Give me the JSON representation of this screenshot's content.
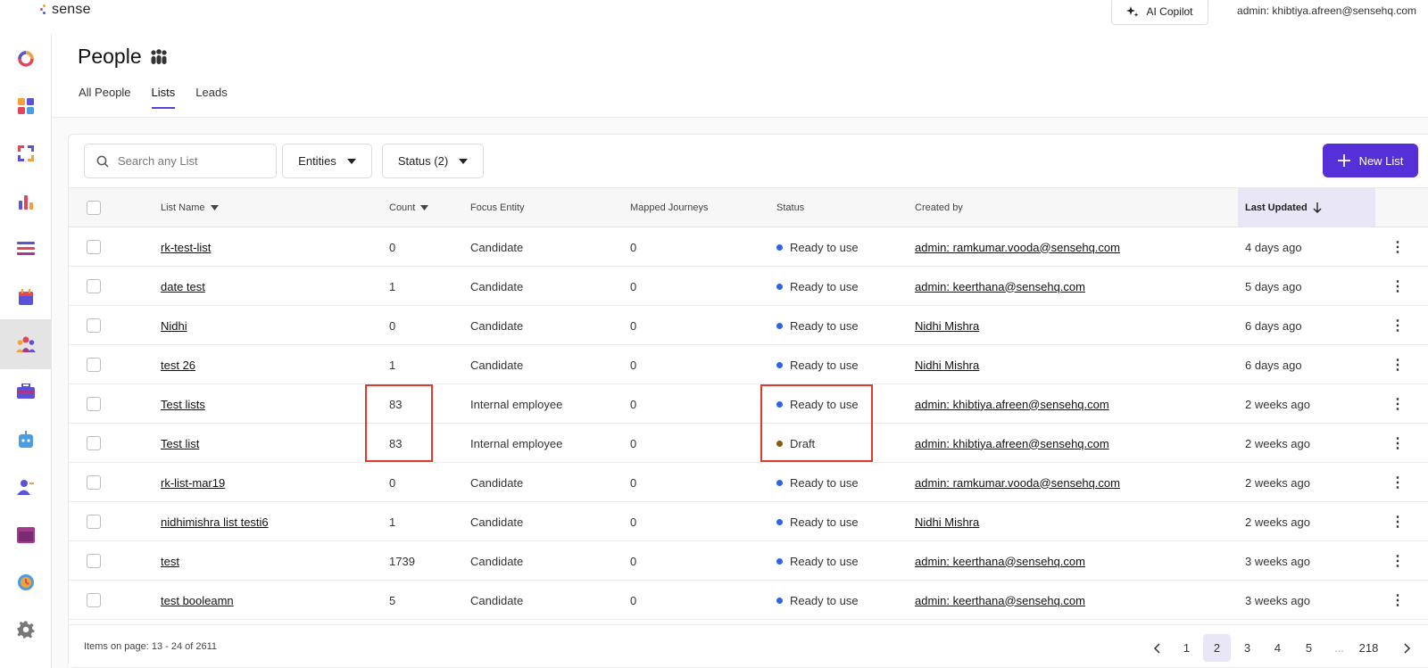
{
  "brand": {
    "name": "sense"
  },
  "topbar": {
    "copilot_label": "AI Copilot",
    "user_label": "admin: khibtiya.afreen@sensehq.com"
  },
  "sidebar": {
    "items": [
      {
        "icon": "ring-icon",
        "active": false
      },
      {
        "icon": "dashboard-icon",
        "active": false
      },
      {
        "icon": "integrations-icon",
        "active": false
      },
      {
        "icon": "analytics-icon",
        "active": false
      },
      {
        "icon": "list-icon",
        "active": false
      },
      {
        "icon": "calendar-icon",
        "active": false
      },
      {
        "icon": "people-icon",
        "active": true
      },
      {
        "icon": "jobs-briefcase-icon",
        "active": false
      },
      {
        "icon": "bot-icon",
        "active": false
      },
      {
        "icon": "user-edit-icon",
        "active": false
      },
      {
        "icon": "window-icon",
        "active": false
      },
      {
        "icon": "clock-icon",
        "active": false
      },
      {
        "icon": "gear-icon",
        "active": false
      }
    ]
  },
  "header": {
    "title": "People",
    "tabs": [
      {
        "label": "All People",
        "active": false
      },
      {
        "label": "Lists",
        "active": true
      },
      {
        "label": "Leads",
        "active": false
      }
    ]
  },
  "toolbar": {
    "search_placeholder": "Search any List",
    "entities_label": "Entities",
    "status_label": "Status (2)",
    "new_list_label": "New List"
  },
  "table": {
    "columns": {
      "list_name": "List Name",
      "count": "Count",
      "focus_entity": "Focus Entity",
      "mapped_journeys": "Mapped Journeys",
      "status": "Status",
      "created_by": "Created by",
      "last_updated": "Last Updated"
    },
    "rows": [
      {
        "name": "rk-test-list",
        "count": "0",
        "focus": "Candidate",
        "journeys": "0",
        "status": "Ready to use",
        "created_by": "admin: ramkumar.vooda@sensehq.com",
        "updated": "4 days ago"
      },
      {
        "name": "date test",
        "count": "1",
        "focus": "Candidate",
        "journeys": "0",
        "status": "Ready to use",
        "created_by": "admin: keerthana@sensehq.com",
        "updated": "5 days ago"
      },
      {
        "name": "Nidhi",
        "count": "0",
        "focus": "Candidate",
        "journeys": "0",
        "status": "Ready to use",
        "created_by": "Nidhi Mishra",
        "updated": "6 days ago"
      },
      {
        "name": "test 26",
        "count": "1",
        "focus": "Candidate",
        "journeys": "0",
        "status": "Ready to use",
        "created_by": "Nidhi Mishra",
        "updated": "6 days ago"
      },
      {
        "name": "Test lists",
        "count": "83",
        "focus": "Internal employee",
        "journeys": "0",
        "status": "Ready to use",
        "created_by": "admin: khibtiya.afreen@sensehq.com",
        "updated": "2 weeks ago"
      },
      {
        "name": "Test list",
        "count": "83",
        "focus": "Internal employee",
        "journeys": "0",
        "status": "Draft",
        "created_by": "admin: khibtiya.afreen@sensehq.com",
        "updated": "2 weeks ago"
      },
      {
        "name": "rk-list-mar19",
        "count": "0",
        "focus": "Candidate",
        "journeys": "0",
        "status": "Ready to use",
        "created_by": "admin: ramkumar.vooda@sensehq.com",
        "updated": "2 weeks ago"
      },
      {
        "name": "nidhimishra list testi6",
        "count": "1",
        "focus": "Candidate",
        "journeys": "0",
        "status": "Ready to use",
        "created_by": "Nidhi Mishra",
        "updated": "2 weeks ago"
      },
      {
        "name": "test",
        "count": "1739",
        "focus": "Candidate",
        "journeys": "0",
        "status": "Ready to use",
        "created_by": "admin: keerthana@sensehq.com",
        "updated": "3 weeks ago"
      },
      {
        "name": "test booleamn",
        "count": "5",
        "focus": "Candidate",
        "journeys": "0",
        "status": "Ready to use",
        "created_by": "admin: keerthana@sensehq.com",
        "updated": "3 weeks ago"
      }
    ]
  },
  "status_colors": {
    "Ready to use": "#2f64e0",
    "Draft": "#8a5a12"
  },
  "footer": {
    "items_label": "Items on page: 13 - 24 of 2611",
    "pages": [
      "1",
      "2",
      "3",
      "4",
      "5",
      "...",
      "218"
    ],
    "current_page": "2"
  },
  "colors": {
    "accent": "#5530d9",
    "highlight": "#e03a2c"
  }
}
